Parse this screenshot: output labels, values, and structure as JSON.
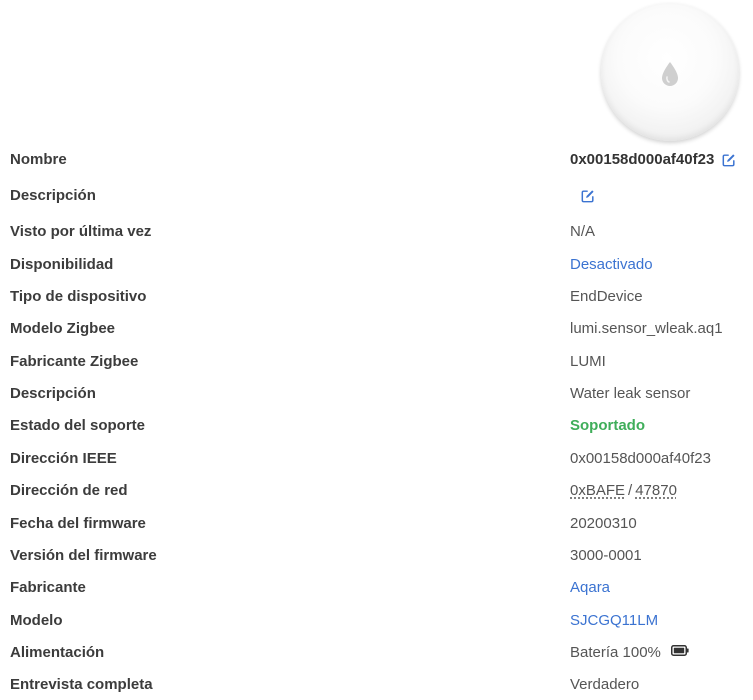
{
  "device": {
    "image_icon": "water-drop-icon",
    "rows": [
      {
        "label": "Nombre",
        "value": "0x00158d000af40f23"
      },
      {
        "label": "Descripción",
        "value": ""
      },
      {
        "label": "Visto por última vez",
        "value": "N/A"
      },
      {
        "label": "Disponibilidad",
        "value": "Desactivado"
      },
      {
        "label": "Tipo de dispositivo",
        "value": "EndDevice"
      },
      {
        "label": "Modelo Zigbee",
        "value": "lumi.sensor_wleak.aq1"
      },
      {
        "label": "Fabricante Zigbee",
        "value": "LUMI"
      },
      {
        "label": "Descripción",
        "value": "Water leak sensor"
      },
      {
        "label": "Estado del soporte",
        "value": "Soportado"
      },
      {
        "label": "Dirección IEEE",
        "value": "0x00158d000af40f23"
      },
      {
        "label": "Dirección de red",
        "value_hex": "0xBAFE",
        "separator": "/",
        "value_dec": "47870"
      },
      {
        "label": "Fecha del firmware",
        "value": "20200310"
      },
      {
        "label": "Versión del firmware",
        "value": "3000-0001"
      },
      {
        "label": "Fabricante",
        "value": "Aqara"
      },
      {
        "label": "Modelo",
        "value": "SJCGQ11LM"
      },
      {
        "label": "Alimentación",
        "value": "Batería 100%",
        "icon": "battery-full-icon"
      },
      {
        "label": "Entrevista completa",
        "value": "Verdadero"
      }
    ]
  },
  "colors": {
    "link": "#3b73d1",
    "success": "#3fae5a",
    "label": "#3c3c3c",
    "value": "#555555"
  }
}
